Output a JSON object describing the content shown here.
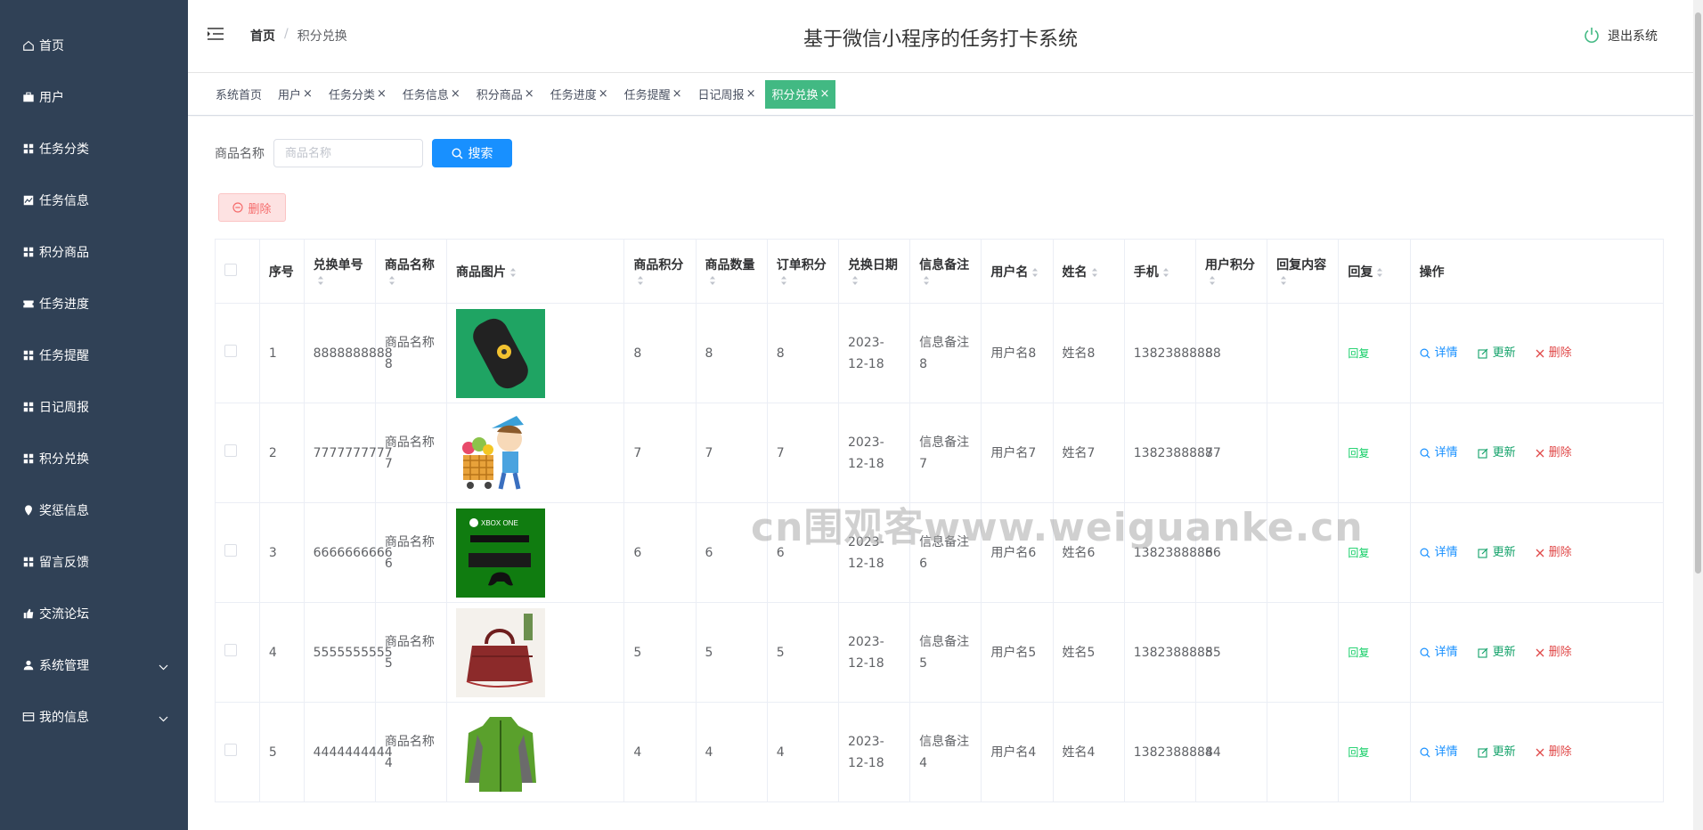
{
  "app": {
    "title": "基于微信小程序的任务打卡系统",
    "logout_label": "退出系统"
  },
  "breadcrumb": {
    "home": "首页",
    "separator": "/",
    "current": "积分兑换"
  },
  "sidebar": {
    "items": [
      {
        "label": "首页",
        "icon": "home-icon"
      },
      {
        "label": "用户",
        "icon": "briefcase-icon"
      },
      {
        "label": "任务分类",
        "icon": "grid-icon"
      },
      {
        "label": "任务信息",
        "icon": "chart-icon"
      },
      {
        "label": "积分商品",
        "icon": "grid-icon"
      },
      {
        "label": "任务进度",
        "icon": "ticket-icon"
      },
      {
        "label": "任务提醒",
        "icon": "grid-icon"
      },
      {
        "label": "日记周报",
        "icon": "grid-icon"
      },
      {
        "label": "积分兑换",
        "icon": "grid-icon"
      },
      {
        "label": "奖惩信息",
        "icon": "location-icon"
      },
      {
        "label": "留言反馈",
        "icon": "grid-icon"
      },
      {
        "label": "交流论坛",
        "icon": "thumb-icon"
      },
      {
        "label": "系统管理",
        "icon": "user-icon",
        "expandable": true
      },
      {
        "label": "我的信息",
        "icon": "card-icon",
        "expandable": true
      }
    ]
  },
  "tags": [
    {
      "label": "系统首页",
      "closable": false
    },
    {
      "label": "用户",
      "closable": true
    },
    {
      "label": "任务分类",
      "closable": true
    },
    {
      "label": "任务信息",
      "closable": true
    },
    {
      "label": "积分商品",
      "closable": true
    },
    {
      "label": "任务进度",
      "closable": true
    },
    {
      "label": "任务提醒",
      "closable": true
    },
    {
      "label": "日记周报",
      "closable": true
    },
    {
      "label": "积分兑换",
      "closable": true,
      "active": true
    }
  ],
  "tag_close_glyph": "×",
  "search": {
    "label": "商品名称",
    "placeholder": "商品名称",
    "value": "",
    "button_label": "搜索"
  },
  "bulk_delete_label": "删除",
  "table": {
    "columns": [
      {
        "label": "序号",
        "sortable": false
      },
      {
        "label": "兑换单号",
        "sortable": true
      },
      {
        "label": "商品名称",
        "sortable": true
      },
      {
        "label": "商品图片",
        "sortable": true
      },
      {
        "label": "商品积分",
        "sortable": true
      },
      {
        "label": "商品数量",
        "sortable": true
      },
      {
        "label": "订单积分",
        "sortable": true
      },
      {
        "label": "兑换日期",
        "sortable": true
      },
      {
        "label": "信息备注",
        "sortable": true
      },
      {
        "label": "用户名",
        "sortable": true
      },
      {
        "label": "姓名",
        "sortable": true
      },
      {
        "label": "手机",
        "sortable": true
      },
      {
        "label": "用户积分",
        "sortable": true
      },
      {
        "label": "回复内容",
        "sortable": true
      },
      {
        "label": "回复",
        "sortable": true
      },
      {
        "label": "操作",
        "sortable": false
      }
    ],
    "rows": [
      {
        "index": "1",
        "order_no": "8888888888",
        "name": "商品名称8",
        "image": "black-gadget",
        "points": "8",
        "qty": "8",
        "order_points": "8",
        "date": "2023-12-18",
        "note": "信息备注8",
        "username": "用户名8",
        "realname": "姓名8",
        "phone": "13823888888",
        "user_points": "8",
        "reply_content": "",
        "reply": "回复"
      },
      {
        "index": "2",
        "order_no": "7777777777",
        "name": "商品名称7",
        "image": "cartoon-boy-cart",
        "points": "7",
        "qty": "7",
        "order_points": "7",
        "date": "2023-12-18",
        "note": "信息备注7",
        "username": "用户名7",
        "realname": "姓名7",
        "phone": "13823888887",
        "user_points": "7",
        "reply_content": "",
        "reply": "回复"
      },
      {
        "index": "3",
        "order_no": "6666666666",
        "name": "商品名称6",
        "image": "xbox-console",
        "points": "6",
        "qty": "6",
        "order_points": "6",
        "date": "2023-12-18",
        "note": "信息备注6",
        "username": "用户名6",
        "realname": "姓名6",
        "phone": "13823888886",
        "user_points": "6",
        "reply_content": "",
        "reply": "回复"
      },
      {
        "index": "4",
        "order_no": "5555555555",
        "name": "商品名称5",
        "image": "red-handbag",
        "points": "5",
        "qty": "5",
        "order_points": "5",
        "date": "2023-12-18",
        "note": "信息备注5",
        "username": "用户名5",
        "realname": "姓名5",
        "phone": "13823888885",
        "user_points": "5",
        "reply_content": "",
        "reply": "回复"
      },
      {
        "index": "5",
        "order_no": "4444444444",
        "name": "商品名称4",
        "image": "green-jacket",
        "points": "4",
        "qty": "4",
        "order_points": "4",
        "date": "2023-12-18",
        "note": "信息备注4",
        "username": "用户名4",
        "realname": "姓名4",
        "phone": "13823888884",
        "user_points": "4",
        "reply_content": "",
        "reply": "回复"
      }
    ],
    "row_actions": {
      "view": "详情",
      "edit": "更新",
      "delete": "删除"
    }
  },
  "xbox_label": "XBOX ONE",
  "watermark": "cn围观客www.weiguanke.cn",
  "colors": {
    "sidebar_bg": "#304156",
    "active_tag": "#42b983",
    "primary": "#1890ff",
    "danger": "#f56c6c",
    "success": "#13ce66"
  }
}
